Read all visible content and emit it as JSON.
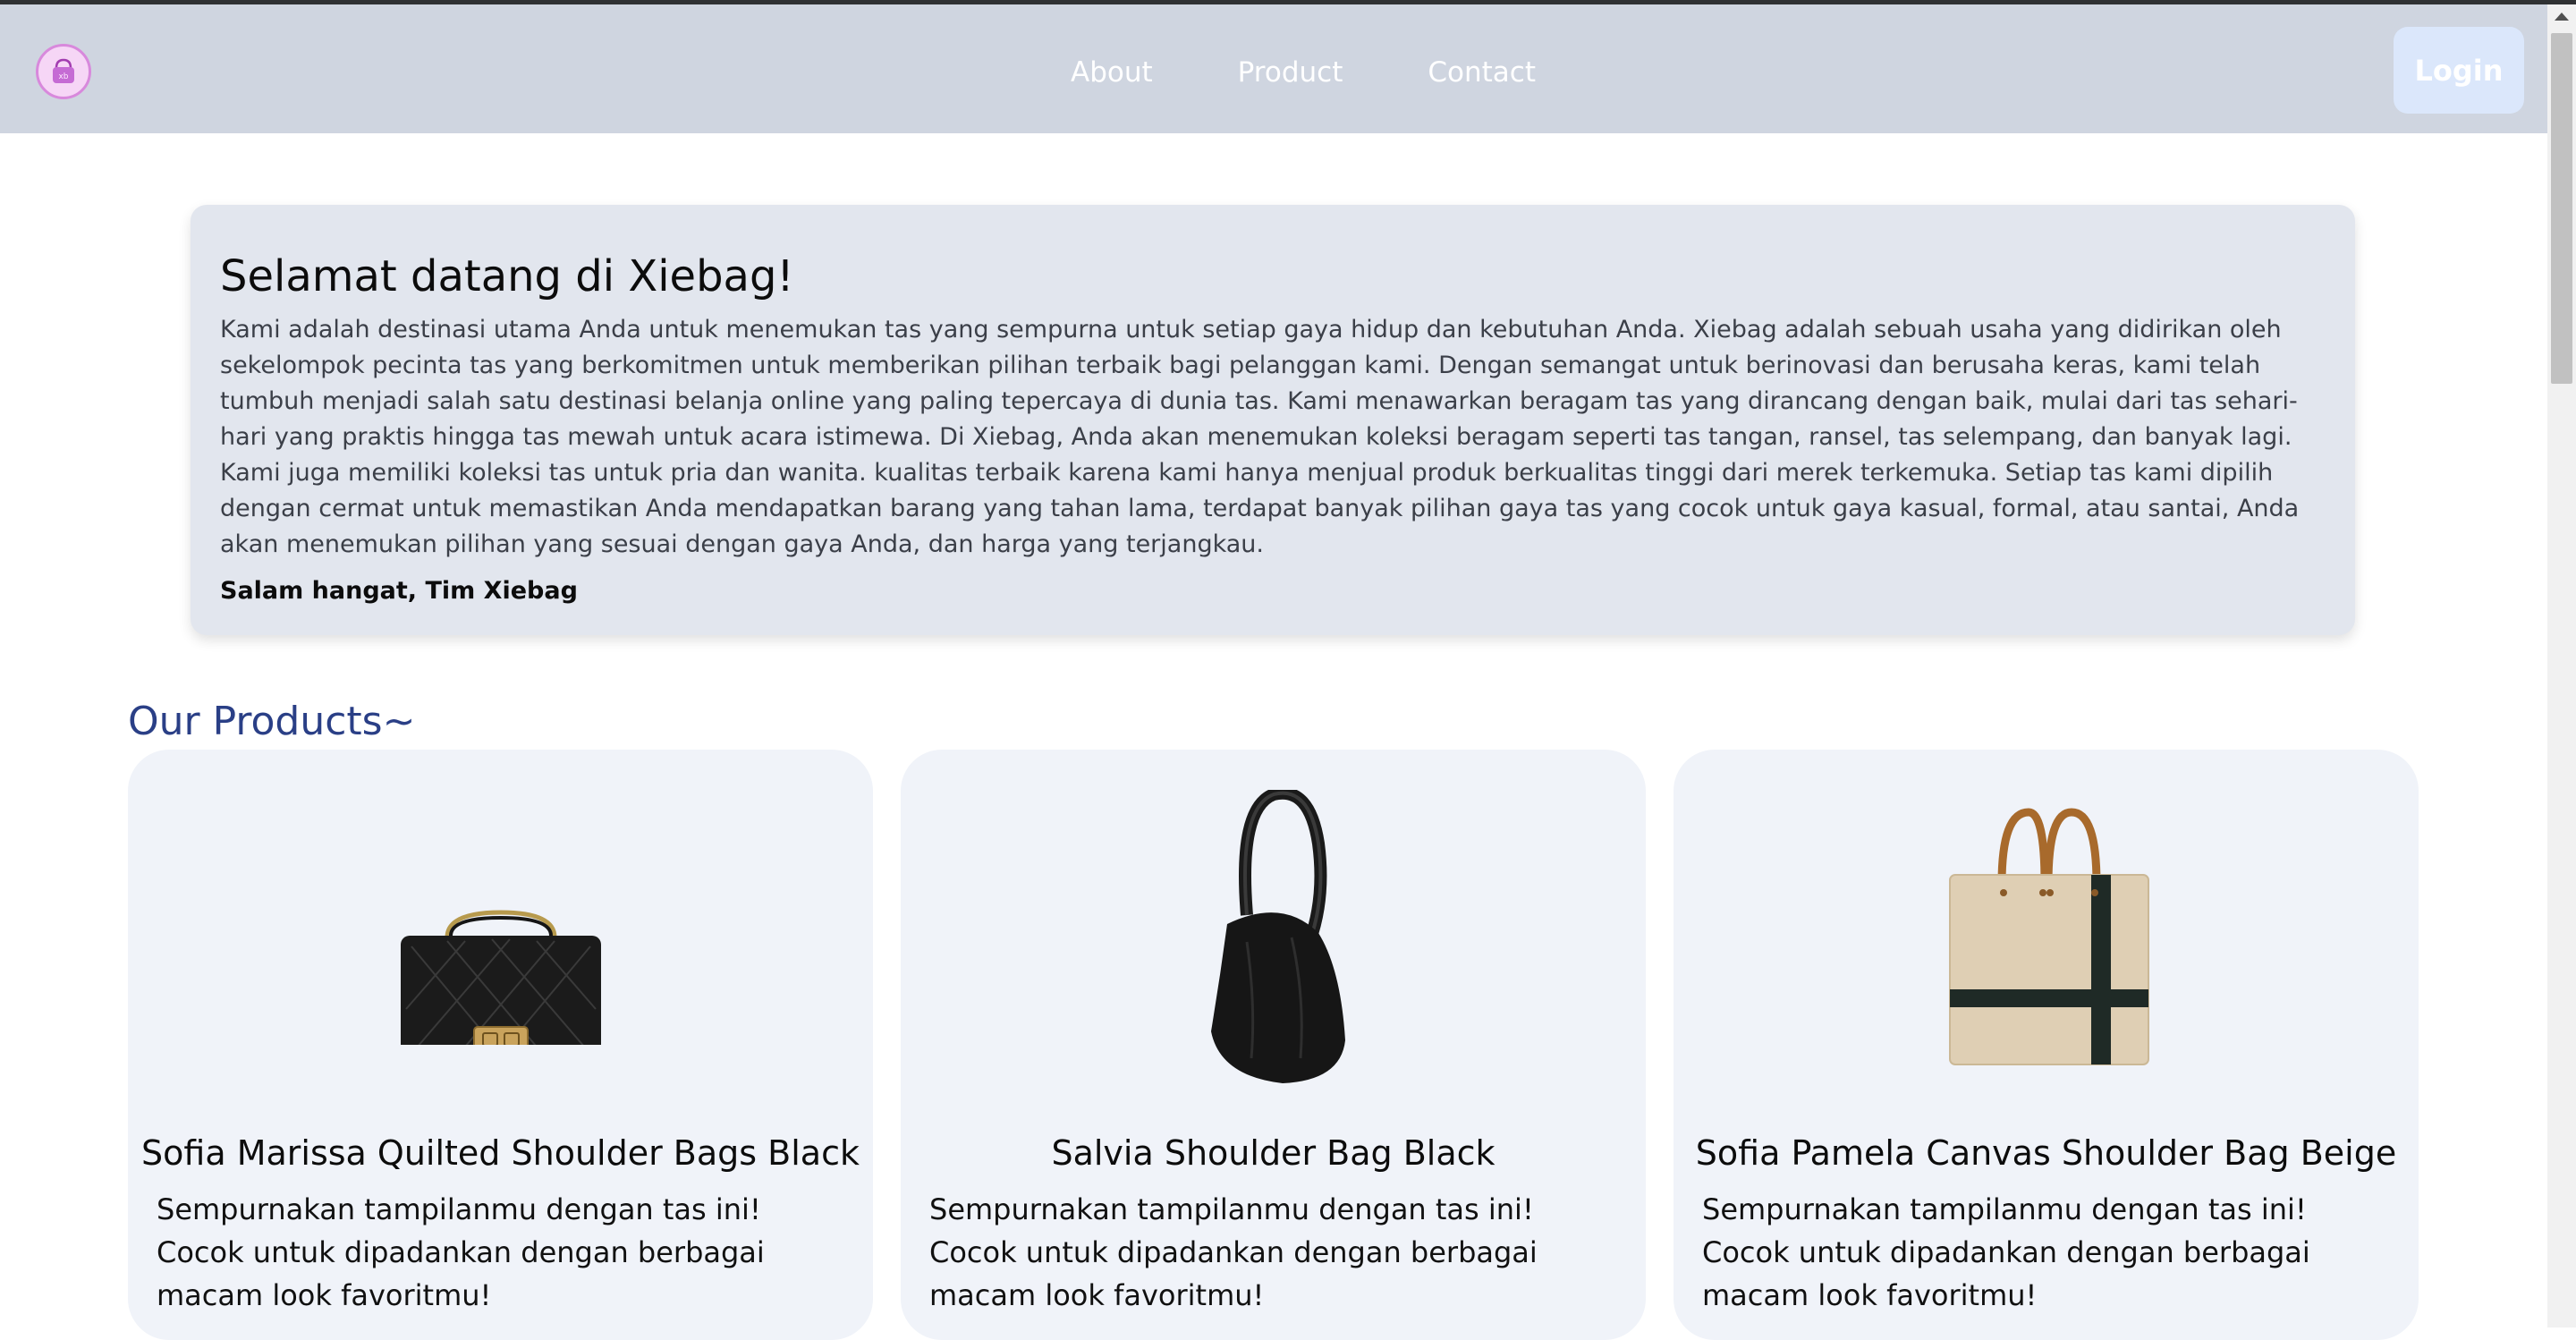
{
  "nav": {
    "links": [
      "About",
      "Product",
      "Contact"
    ],
    "login_label": "Login",
    "logo_icon": "handbag-logo-icon"
  },
  "welcome": {
    "title": "Selamat datang di Xiebag!",
    "body": "Kami adalah destinasi utama Anda untuk menemukan tas yang sempurna untuk setiap gaya hidup dan kebutuhan Anda. Xiebag adalah sebuah usaha yang didirikan oleh sekelompok pecinta tas yang berkomitmen untuk memberikan pilihan terbaik bagi pelanggan kami. Dengan semangat untuk berinovasi dan berusaha keras, kami telah tumbuh menjadi salah satu destinasi belanja online yang paling tepercaya di dunia tas. Kami menawarkan beragam tas yang dirancang dengan baik, mulai dari tas sehari-hari yang praktis hingga tas mewah untuk acara istimewa. Di Xiebag, Anda akan menemukan koleksi beragam seperti tas tangan, ransel, tas selempang, dan banyak lagi. Kami juga memiliki koleksi tas untuk pria dan wanita. kualitas terbaik karena kami hanya menjual produk berkualitas tinggi dari merek terkemuka. Setiap tas kami dipilih dengan cermat untuk memastikan Anda mendapatkan barang yang tahan lama, terdapat banyak pilihan gaya tas yang cocok untuk gaya kasual, formal, atau santai, Anda akan menemukan pilihan yang sesuai dengan gaya Anda, dan harga yang terjangkau.",
    "signature": "Salam hangat, Tim Xiebag"
  },
  "products": {
    "heading": "Our Products~",
    "items": [
      {
        "name": "Sofia Marissa Quilted Shoulder Bags Black",
        "desc_line1": "Sempurnakan tampilanmu dengan tas ini!",
        "desc_line2": "Cocok untuk dipadankan dengan berbagai macam look favoritmu!",
        "image_icon": "quilted-black-bag-image"
      },
      {
        "name": "Salvia Shoulder Bag Black",
        "desc_line1": "Sempurnakan tampilanmu dengan tas ini!",
        "desc_line2": "Cocok untuk dipadankan dengan berbagai macam look favoritmu!",
        "image_icon": "black-hobo-bag-image"
      },
      {
        "name": "Sofia Pamela Canvas Shoulder Bag Beige",
        "desc_line1": "Sempurnakan tampilanmu dengan tas ini!",
        "desc_line2": "Cocok untuk dipadankan dengan berbagai macam look favoritmu!",
        "image_icon": "beige-canvas-tote-image"
      }
    ]
  },
  "colors": {
    "navbar": "#cfd5e0",
    "welcome_bg": "#e2e6ee",
    "heading_blue": "#2a3f86",
    "card_bg": "#f0f3f9",
    "login_bg": "#dbe7fb"
  }
}
